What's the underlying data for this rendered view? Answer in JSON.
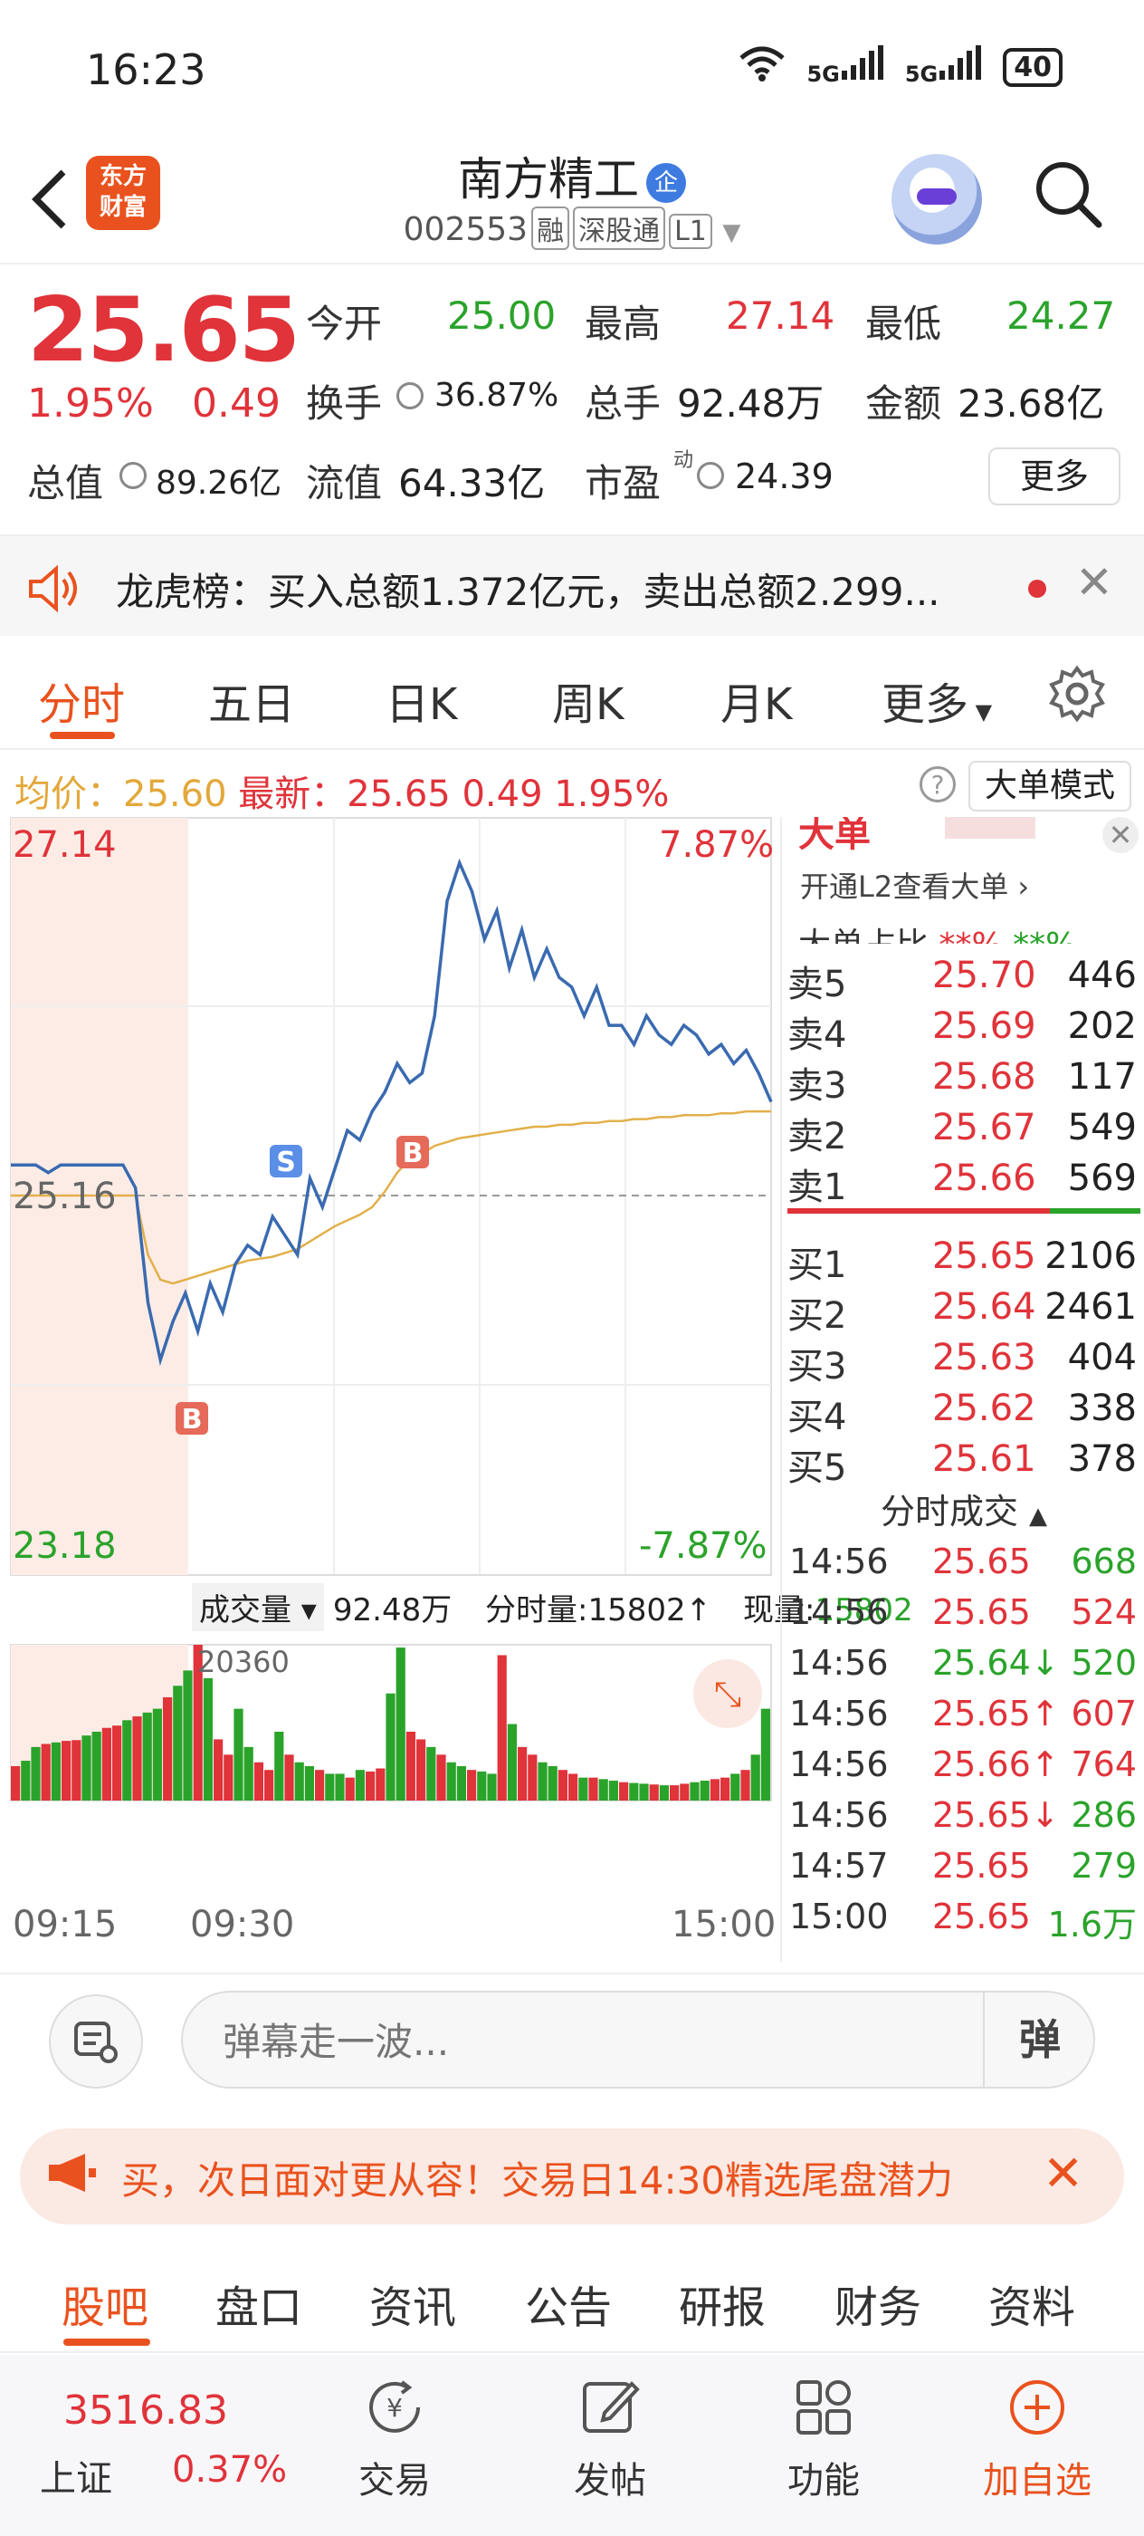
{
  "status": {
    "time": "16:23",
    "net1": "5G",
    "net2": "5G",
    "battery": "40"
  },
  "header": {
    "stock_name": "南方精工",
    "badge": "企",
    "code": "002553",
    "tags": [
      "融",
      "深股通",
      "L1"
    ],
    "logo_text": [
      "东方",
      "财富"
    ]
  },
  "quote": {
    "price": "25.65",
    "change_pct": "1.95%",
    "change": "0.49",
    "open_label": "今开",
    "open": "25.00",
    "high_label": "最高",
    "high": "27.14",
    "low_label": "最低",
    "low": "24.27",
    "turnover_label": "换手",
    "turnover": "36.87%",
    "vol_label": "总手",
    "vol": "92.48万",
    "amount_label": "金额",
    "amount": "23.68亿",
    "mcap_label": "总值",
    "mcap": "89.26亿",
    "float_label": "流值",
    "float": "64.33亿",
    "pe_label": "市盈",
    "pe_sup": "动",
    "pe": "24.39",
    "more": "更多"
  },
  "dragon": {
    "text": "龙虎榜：买入总额1.372亿元，卖出总额2.299..."
  },
  "tabs": [
    "分时",
    "五日",
    "日K",
    "周K",
    "月K",
    "更多"
  ],
  "info": {
    "avg_label": "均价：",
    "avg": "25.60",
    "last_label": "最新：",
    "last": "25.65",
    "chg": "0.49",
    "pct": "1.95%",
    "big_mode": "大单模式"
  },
  "chart_data": {
    "type": "line",
    "y_max_label": "27.14",
    "y_mid_label": "25.16",
    "y_min_label": "23.18",
    "pct_max_label": "7.87%",
    "pct_min_label": "-7.87%",
    "ylim": [
      23.18,
      27.14
    ],
    "prev_close": 25.16,
    "x_labels": [
      "09:15",
      "09:30",
      "15:00"
    ],
    "series": [
      {
        "values": [
          25.32,
          25.32,
          25.32,
          25.28,
          25.32,
          25.32,
          25.32,
          25.32,
          25.32,
          25.32,
          25.2,
          24.6,
          24.3,
          24.5,
          24.65,
          24.45,
          24.7,
          24.55,
          24.8,
          24.9,
          24.85,
          25.05,
          24.95,
          24.85,
          25.25,
          25.1,
          25.3,
          25.5,
          25.45,
          25.6,
          25.7,
          25.85,
          25.75,
          25.8,
          26.1,
          26.7,
          26.9,
          26.75,
          26.5,
          26.65,
          26.35,
          26.55,
          26.3,
          26.45,
          26.3,
          26.25,
          26.1,
          26.25,
          26.05,
          26.05,
          25.95,
          26.1,
          26.0,
          25.95,
          26.05,
          26.0,
          25.9,
          25.95,
          25.85,
          25.92,
          25.8,
          25.65
        ]
      },
      {
        "values": [
          25.16,
          25.16,
          25.16,
          25.16,
          25.16,
          25.16,
          25.16,
          25.16,
          25.16,
          25.16,
          25.16,
          24.85,
          24.72,
          24.7,
          24.72,
          24.74,
          24.76,
          24.78,
          24.8,
          24.82,
          24.83,
          24.84,
          24.86,
          24.88,
          24.92,
          24.96,
          25.0,
          25.03,
          25.06,
          25.1,
          25.18,
          25.28,
          25.35,
          25.38,
          25.42,
          25.44,
          25.46,
          25.47,
          25.48,
          25.49,
          25.5,
          25.51,
          25.52,
          25.52,
          25.53,
          25.53,
          25.54,
          25.54,
          25.55,
          25.55,
          25.56,
          25.56,
          25.57,
          25.57,
          25.58,
          25.58,
          25.58,
          25.59,
          25.59,
          25.6,
          25.6,
          25.6
        ]
      }
    ],
    "volume_values": [
      4500,
      5200,
      7000,
      7400,
      7600,
      7800,
      7900,
      8500,
      9000,
      9500,
      9800,
      10500,
      11000,
      11500,
      12000,
      13500,
      15000,
      17000,
      20360,
      16000,
      8000,
      6000,
      12000,
      7000,
      5000,
      4000,
      9000,
      6000,
      5000,
      4500,
      4000,
      3500,
      3500,
      3000,
      4000,
      3800,
      4200,
      14000,
      20000,
      9000,
      8000,
      7000,
      6000,
      5000,
      4500,
      4000,
      3800,
      3500,
      19000,
      10000,
      7000,
      6000,
      5000,
      4500,
      4000,
      3500,
      3000,
      3000,
      2800,
      2600,
      2400,
      2300,
      2200,
      2100,
      2000,
      2000,
      2200,
      2400,
      2600,
      2800,
      3000,
      3500,
      4000,
      6000,
      12000
    ],
    "vol_peak_label": "20360",
    "markers": [
      "S",
      "B",
      "B"
    ]
  },
  "volume_header": {
    "selector": "成交量",
    "total": "92.48万",
    "tick_label": "分时量:",
    "tick": "15802",
    "now_label": "现量:",
    "now": "15802"
  },
  "side": {
    "big_title": "大单",
    "l2_text": "开通L2查看大单",
    "ratio_text": "大单占比",
    "asks": [
      {
        "label": "卖5",
        "price": "25.70",
        "vol": "446"
      },
      {
        "label": "卖4",
        "price": "25.69",
        "vol": "202"
      },
      {
        "label": "卖3",
        "price": "25.68",
        "vol": "117"
      },
      {
        "label": "卖2",
        "price": "25.67",
        "vol": "549"
      },
      {
        "label": "卖1",
        "price": "25.66",
        "vol": "569"
      }
    ],
    "bids": [
      {
        "label": "买1",
        "price": "25.65",
        "vol": "2106"
      },
      {
        "label": "买2",
        "price": "25.64",
        "vol": "2461"
      },
      {
        "label": "买3",
        "price": "25.63",
        "vol": "404"
      },
      {
        "label": "买4",
        "price": "25.62",
        "vol": "338"
      },
      {
        "label": "买5",
        "price": "25.61",
        "vol": "378"
      }
    ],
    "trades_title": "分时成交",
    "trades": [
      {
        "time": "14:56",
        "price": "25.65",
        "vol": "668",
        "pc": "#e0333a",
        "vc": "#2aa32a"
      },
      {
        "time": "14:56",
        "price": "25.65",
        "vol": "524",
        "pc": "#e0333a",
        "vc": "#e0333a"
      },
      {
        "time": "14:56",
        "price": "25.64↓",
        "vol": "520",
        "pc": "#2aa32a",
        "vc": "#2aa32a"
      },
      {
        "time": "14:56",
        "price": "25.65↑",
        "vol": "607",
        "pc": "#e0333a",
        "vc": "#e0333a"
      },
      {
        "time": "14:56",
        "price": "25.66↑",
        "vol": "764",
        "pc": "#e0333a",
        "vc": "#e0333a"
      },
      {
        "time": "14:56",
        "price": "25.65↓",
        "vol": "286",
        "pc": "#e0333a",
        "vc": "#2aa32a"
      },
      {
        "time": "14:57",
        "price": "25.65",
        "vol": "279",
        "pc": "#e0333a",
        "vc": "#2aa32a"
      },
      {
        "time": "15:00",
        "price": "25.65",
        "vol": "1.6万",
        "pc": "#e0333a",
        "vc": "#2aa32a"
      }
    ]
  },
  "comment": {
    "placeholder": "弹幕走一波...",
    "danmu": "弹"
  },
  "promo": {
    "text": "买，次日面对更从容！交易日14:30精选尾盘潜力"
  },
  "bottom_tabs": [
    "股吧",
    "盘口",
    "资讯",
    "公告",
    "研报",
    "财务",
    "资料"
  ],
  "nav": {
    "index_value": "3516.83",
    "index_name": "上证",
    "index_change": "0.37%",
    "items": [
      "交易",
      "发帖",
      "功能",
      "加自选"
    ]
  },
  "colors": {
    "up": "#e0333a",
    "down": "#2aa32a",
    "accent": "#e9521e",
    "price_line": "#3a6ab0",
    "avg_line": "#e2b04a"
  }
}
